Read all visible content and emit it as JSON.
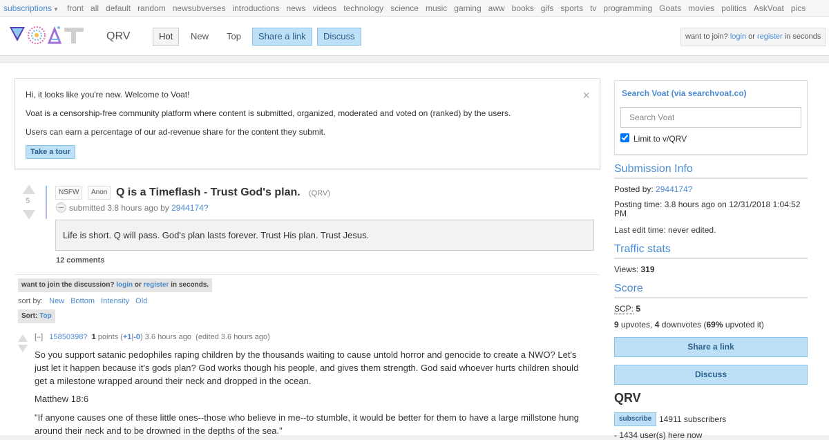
{
  "topbar": {
    "subscriptions_label": "subscriptions",
    "links": [
      "front",
      "all",
      "default",
      "random",
      "newsubverses",
      "introductions",
      "news",
      "videos",
      "technology",
      "science",
      "music",
      "gaming",
      "aww",
      "books",
      "gifs",
      "sports",
      "tv",
      "programming",
      "Goats",
      "movies",
      "politics",
      "AskVoat",
      "pics"
    ]
  },
  "header": {
    "subverse": "QRV",
    "tabs": [
      "Hot",
      "New",
      "Top"
    ],
    "share_link": "Share a link",
    "discuss": "Discuss",
    "join_text": "want to join?",
    "login": "login",
    "or": "or",
    "register": "register",
    "in_seconds": "in seconds"
  },
  "welcome": {
    "line1": "Hi, it looks like you're new. Welcome to Voat!",
    "line2": "Voat is a censorship-free community platform where content is submitted, organized, moderated and voted on (ranked) by the users.",
    "line3": "Users can earn a percentage of our ad-revenue share for the content they submit.",
    "close": "×",
    "tour_button": "Take a tour"
  },
  "post": {
    "score": "5",
    "tags": [
      "NSFW",
      "Anon"
    ],
    "title": "Q is a Timeflash - Trust God's plan.",
    "subverse": "(QRV)",
    "submitted": "submitted 3.8 hours ago by",
    "author": "2944174?",
    "body": "Life is short. Q will pass. God's plan lasts forever. Trust His plan. Trust Jesus.",
    "comments_count": "12 comments"
  },
  "discussion": {
    "join_text": "want to join the discussion?",
    "login": "login",
    "or": "or",
    "register": "register",
    "in_seconds": "in seconds.",
    "sort_by_label": "sort by:",
    "sort_options": [
      "New",
      "Bottom",
      "Intensity",
      "Old"
    ],
    "current_sort_label": "Sort:",
    "current_sort": "Top"
  },
  "comment": {
    "collapse": "[–]",
    "author": "15850398?",
    "points": "1",
    "points_label": "points (",
    "up": "+1",
    "sep": "|",
    "down": "-0",
    "time": ") 3.6 hours ago",
    "edited": "(edited 3.6 hours ago)",
    "para1": "So you support satanic pedophiles raping children by the thousands waiting to cause untold horror and genocide to create a NWO? Let's just let it happen because it's gods plan? God works though his people, and gives them strength. God said whoever hurts children should get a milestone wrapped around their neck and dropped in the ocean.",
    "para2": "Matthew 18:6",
    "para3": "\"If anyone causes one of these little ones--those who believe in me--to stumble, it would be better for them to have a large millstone hung around their neck and to be drowned in the depths of the sea.\""
  },
  "sidebar": {
    "search_title": "Search Voat (via searchvoat.co)",
    "search_placeholder": "Search Voat",
    "limit_label": "Limit to v/QRV",
    "submission_info": "Submission Info",
    "posted_by_label": "Posted by:",
    "posted_by": "2944174?",
    "posting_time": "Posting time: 3.8 hours ago on 12/31/2018 1:04:52 PM",
    "last_edit": "Last edit time: never edited.",
    "traffic_stats": "Traffic stats",
    "views_label": "Views:",
    "views": "319",
    "score_heading": "Score",
    "scp_label": "SCP:",
    "scp": "5",
    "upvotes": "9",
    "upvotes_label": "upvotes,",
    "downvotes": "4",
    "downvotes_label": "downvotes (",
    "upvoted_pct": "69%",
    "upvoted_label": "upvoted it)",
    "share_link": "Share a link",
    "discuss": "Discuss",
    "subverse_name": "QRV",
    "subscribe": "subscribe",
    "subscribers": "14911 subscribers",
    "online": "- 1434 user(s) here now"
  }
}
